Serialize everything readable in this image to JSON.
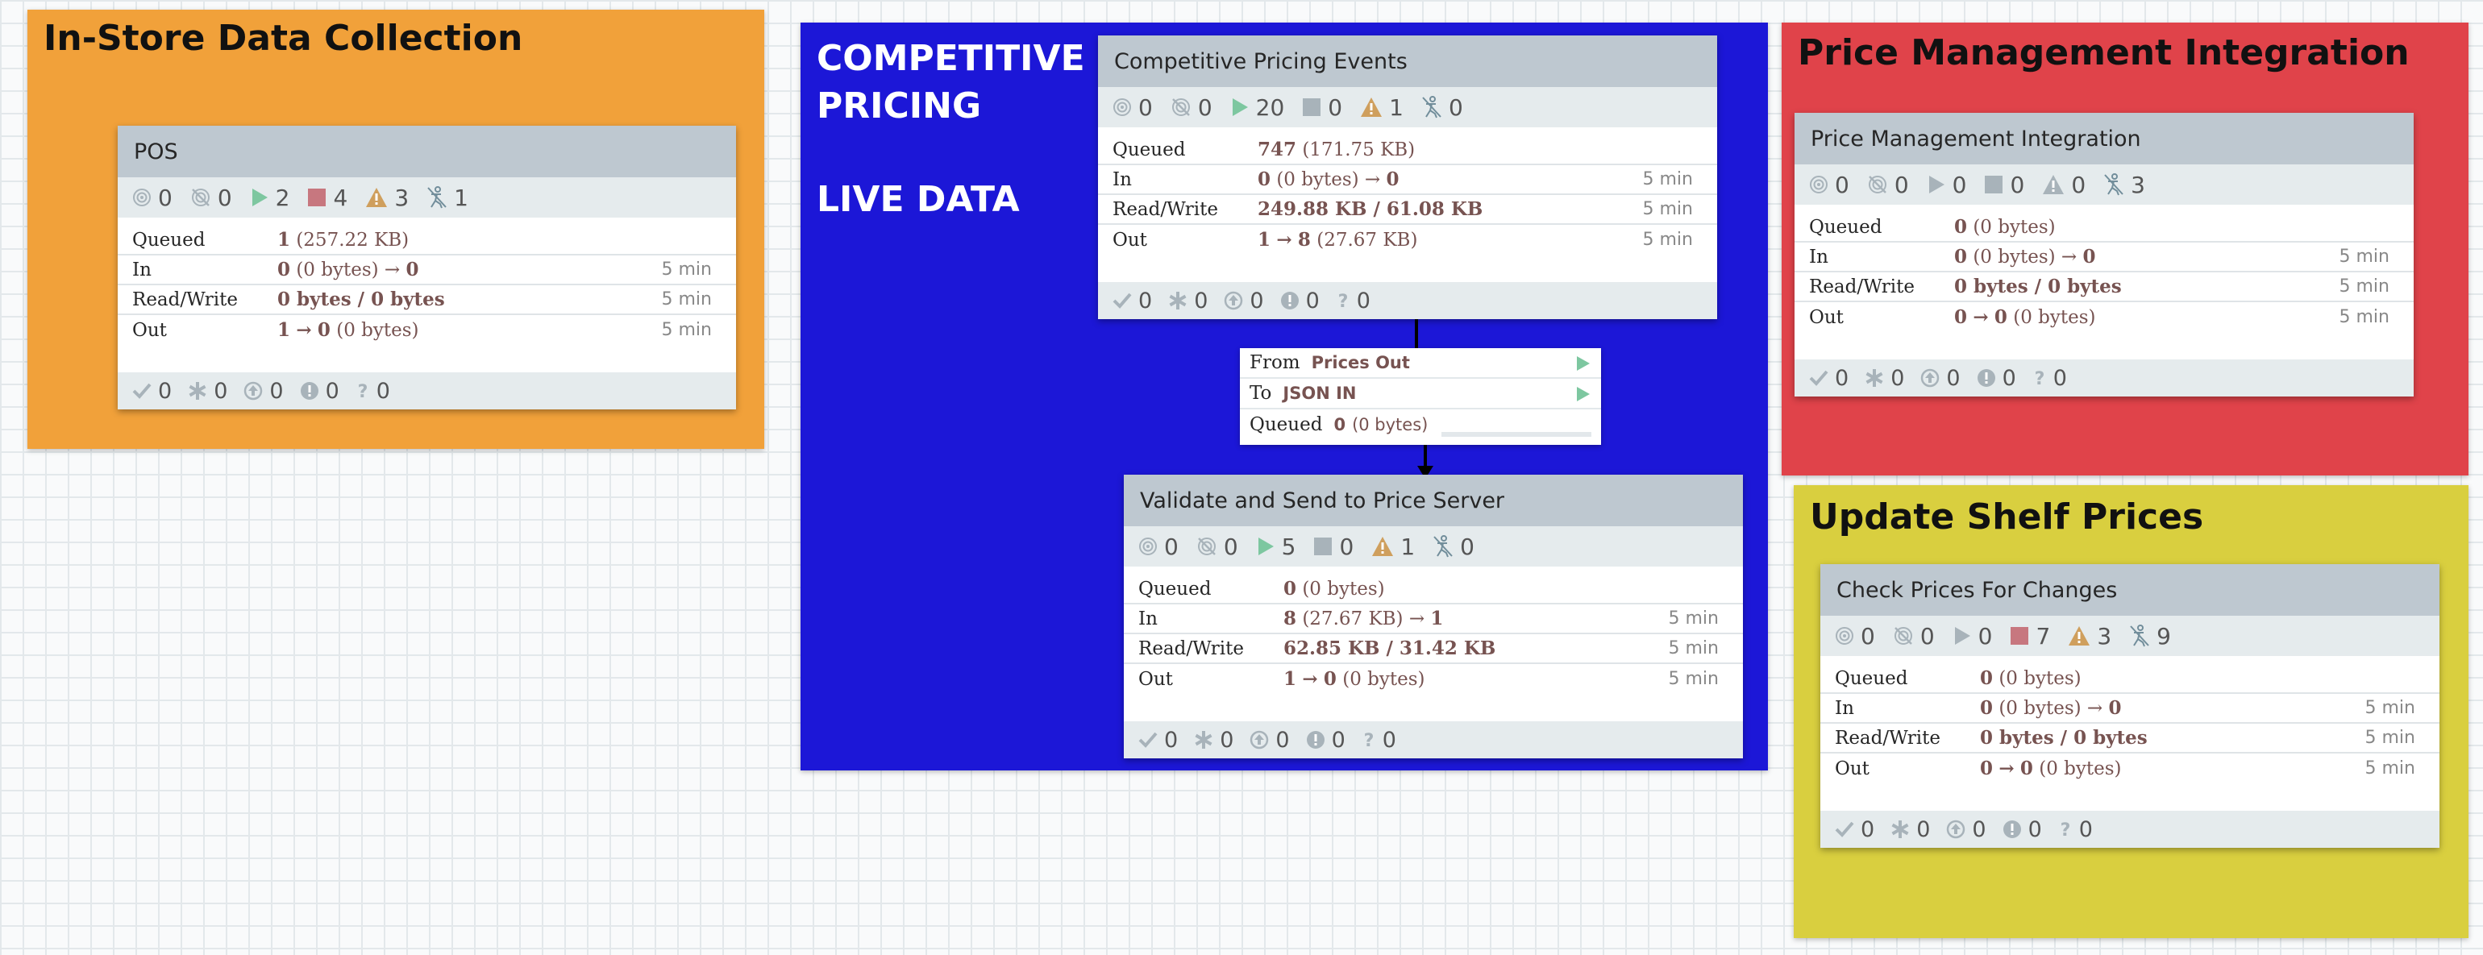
{
  "labels": {
    "instore": {
      "title": "In-Store Data Collection",
      "color": "#f1a13a"
    },
    "competitive": {
      "title_line1": "COMPETITIVE",
      "title_line2": "PRICING",
      "title_line3": "LIVE DATA",
      "color": "#1c17d7"
    },
    "price_mgmt": {
      "title": "Price Management Integration",
      "color": "#e0434a"
    },
    "shelf": {
      "title": "Update Shelf Prices",
      "color": "#d9cf3f"
    }
  },
  "groups": {
    "pos": {
      "name": "POS",
      "stats": {
        "transmitting": "0",
        "not_transmitting": "0",
        "running": "2",
        "stopped": "4",
        "invalid": "3",
        "disabled": "1"
      },
      "queued": {
        "count": "1",
        "size": "(257.22 KB)"
      },
      "in": {
        "count": "0",
        "size": "(0 bytes)",
        "arrow": "→",
        "out": "0"
      },
      "read_write": "0 bytes / 0 bytes",
      "out": {
        "from": "1",
        "arrow": "→",
        "to": "0",
        "size": "(0 bytes)"
      },
      "footer": {
        "up_to_date": "0",
        "locally_modified": "0",
        "stale": "0",
        "sync_failure": "0",
        "unknown": "0"
      }
    },
    "cpe": {
      "name": "Competitive Pricing Events",
      "stats": {
        "transmitting": "0",
        "not_transmitting": "0",
        "running": "20",
        "stopped": "0",
        "invalid": "1",
        "disabled": "0"
      },
      "queued": {
        "count": "747",
        "size": "(171.75 KB)"
      },
      "in": {
        "count": "0",
        "size": "(0 bytes)",
        "arrow": "→",
        "out": "0"
      },
      "read_write": "249.88 KB / 61.08 KB",
      "out": {
        "from": "1",
        "arrow": "→",
        "to": "8",
        "size": "(27.67 KB)"
      },
      "footer": {
        "up_to_date": "0",
        "locally_modified": "0",
        "stale": "0",
        "sync_failure": "0",
        "unknown": "0"
      }
    },
    "validate": {
      "name": "Validate and Send to Price Server",
      "stats": {
        "transmitting": "0",
        "not_transmitting": "0",
        "running": "5",
        "stopped": "0",
        "invalid": "1",
        "disabled": "0"
      },
      "queued": {
        "count": "0",
        "size": "(0 bytes)"
      },
      "in": {
        "count": "8",
        "size": "(27.67 KB)",
        "arrow": "→",
        "out": "1"
      },
      "read_write": "62.85 KB / 31.42 KB",
      "out": {
        "from": "1",
        "arrow": "→",
        "to": "0",
        "size": "(0 bytes)"
      },
      "footer": {
        "up_to_date": "0",
        "locally_modified": "0",
        "stale": "0",
        "sync_failure": "0",
        "unknown": "0"
      }
    },
    "pmi": {
      "name": "Price Management Integration",
      "stats": {
        "transmitting": "0",
        "not_transmitting": "0",
        "running": "0",
        "stopped": "0",
        "invalid": "0",
        "disabled": "3"
      },
      "queued": {
        "count": "0",
        "size": "(0 bytes)"
      },
      "in": {
        "count": "0",
        "size": "(0 bytes)",
        "arrow": "→",
        "out": "0"
      },
      "read_write": "0 bytes / 0 bytes",
      "out": {
        "from": "0",
        "arrow": "→",
        "to": "0",
        "size": "(0 bytes)"
      },
      "footer": {
        "up_to_date": "0",
        "locally_modified": "0",
        "stale": "0",
        "sync_failure": "0",
        "unknown": "0"
      }
    },
    "check": {
      "name": "Check Prices For Changes",
      "stats": {
        "transmitting": "0",
        "not_transmitting": "0",
        "running": "0",
        "stopped": "7",
        "invalid": "3",
        "disabled": "9"
      },
      "queued": {
        "count": "0",
        "size": "(0 bytes)"
      },
      "in": {
        "count": "0",
        "size": "(0 bytes)",
        "arrow": "→",
        "out": "0"
      },
      "read_write": "0 bytes / 0 bytes",
      "out": {
        "from": "0",
        "arrow": "→",
        "to": "0",
        "size": "(0 bytes)"
      },
      "footer": {
        "up_to_date": "0",
        "locally_modified": "0",
        "stale": "0",
        "sync_failure": "0",
        "unknown": "0"
      }
    }
  },
  "row_labels": {
    "queued": "Queued",
    "in": "In",
    "read_write": "Read/Write",
    "out": "Out",
    "time": "5 min"
  },
  "connection": {
    "from_label": "From",
    "from_value": "Prices Out",
    "to_label": "To",
    "to_value": "JSON IN",
    "queued_label": "Queued",
    "queued_count": "0",
    "queued_size": "(0 bytes)"
  },
  "icons": {
    "transmitting": "transmitting-icon",
    "not_transmitting": "not-transmitting-icon",
    "running": "play-icon",
    "stopped": "stop-icon",
    "invalid": "warning-icon",
    "disabled": "disabled-icon",
    "up_to_date": "check-icon",
    "locally_modified": "asterisk-icon",
    "stale": "up-arrow-icon",
    "sync_failure": "exclamation-icon",
    "unknown": "question-icon"
  }
}
